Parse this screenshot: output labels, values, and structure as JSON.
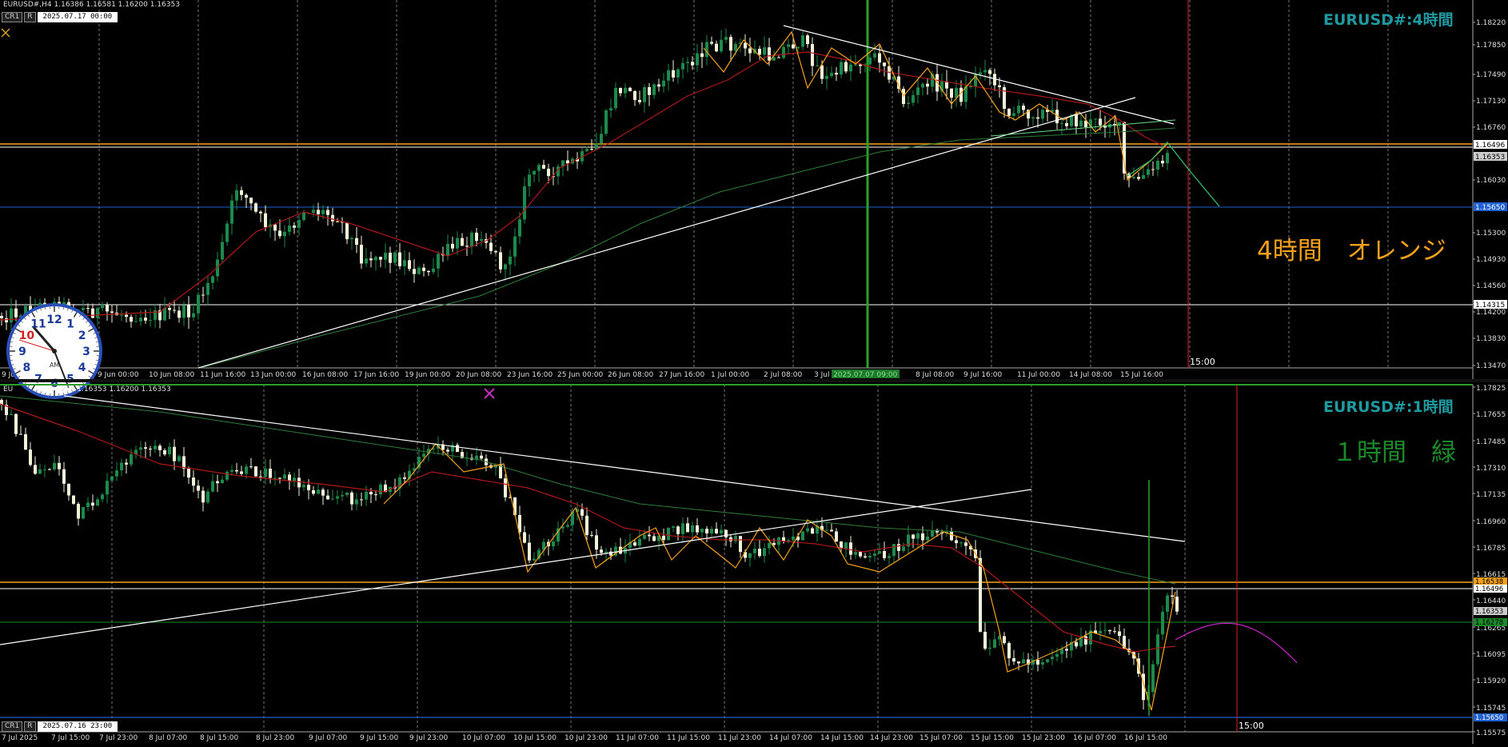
{
  "top_pane": {
    "info": "EURUSD#,H4  1.16386 1.16581 1.16200 1.16353",
    "cr_label": "CR1",
    "r_label": "R",
    "crosshair_date": "2025.07.17 00:00",
    "title": "EURUSD#:4時間",
    "note": "4時間　オレンジ",
    "note_color": "#f5a11c",
    "price_scale": [
      "1.18220",
      "1.17850",
      "1.17490",
      "1.17130",
      "1.16760",
      "1.16030",
      "1.15300",
      "1.14930",
      "1.14560",
      "1.14200",
      "1.13830",
      "1.13470"
    ],
    "price_tags": [
      {
        "label": "1.16496",
        "color": "#ffffff",
        "text_color": "#000000"
      },
      {
        "label": "1.16353",
        "color": "#cccccc",
        "text_color": "#000000"
      },
      {
        "label": "1.15650",
        "color": "#2060d0",
        "text_color": "#ffffff"
      },
      {
        "label": "1.14315",
        "color": "#ffffff",
        "text_color": "#000000"
      }
    ],
    "time_labels": [
      "9 Jun",
      "9 Jun 00:00",
      "10 Jun 08:00",
      "11 Jun 16:00",
      "13 Jun 00:00",
      "16 Jun 08:00",
      "17 Jun 16:00",
      "19 Jun 00:00",
      "20 Jun 08:00",
      "23 Jun 16:00",
      "25 Jun 00:00",
      "26 Jun 08:00",
      "27 Jun 16:00",
      "1 Jul 00:00",
      "2 Jul 08:00",
      "3 Jul",
      "2025.07.07 09:00",
      "8 Jul 08:00",
      "9 Jul 16:00",
      "11 Jul 00:00",
      "14 Jul 08:00",
      "15 Jul 16:00"
    ],
    "marker_time": "15:00"
  },
  "bottom_pane": {
    "info": "EURUSD#,H1  1.16278 1.16353 1.16200 1.16353",
    "info_short": "EU",
    "info_tail": "278 1.16353 1.16200 1.16353",
    "cr_label": "CR1",
    "r_label": "R",
    "crosshair_date": "2025.07.16 23:00",
    "title": "EURUSD#:1時間",
    "note": "１時間　緑",
    "note_color": "#1b8a2a",
    "price_scale": [
      "1.17825",
      "1.17655",
      "1.17485",
      "1.17310",
      "1.17135",
      "1.16960",
      "1.16785",
      "1.16615",
      "1.16440",
      "1.16265",
      "1.16095",
      "1.15920",
      "1.15745",
      "1.15575"
    ],
    "price_tags": [
      {
        "label": "1.16538",
        "color": "#f5a11c",
        "text_color": "#000000"
      },
      {
        "label": "1.16496",
        "color": "#ffffff",
        "text_color": "#000000"
      },
      {
        "label": "1.16353",
        "color": "#cccccc",
        "text_color": "#000000"
      },
      {
        "label": "1.16278",
        "color": "#1b8a2a",
        "text_color": "#000000"
      },
      {
        "label": "1.15650",
        "color": "#2060d0",
        "text_color": "#ffffff"
      }
    ],
    "time_labels": [
      "7 Jul 2025",
      "7 Jul 15:00",
      "7 Jul 23:00",
      "8 Jul 07:00",
      "8 Jul 15:00",
      "8 Jul 23:00",
      "9 Jul 07:00",
      "9 Jul 15:00",
      "9 Jul 23:00",
      "10 Jul 07:00",
      "10 Jul 15:00",
      "10 Jul 23:00",
      "11 Jul 07:00",
      "11 Jul 15:00",
      "11 Jul 23:00",
      "14 Jul 07:00",
      "14 Jul 15:00",
      "14 Jul 23:00",
      "15 Jul 07:00",
      "15 Jul 15:00",
      "15 Jul 23:00",
      "16 Jul 07:00",
      "16 Jul 15:00"
    ],
    "marker_time": "15:00"
  },
  "clock": {
    "numerals": [
      "12",
      "1",
      "2",
      "3",
      "4",
      "5",
      "6",
      "7",
      "8",
      "9",
      "10",
      "11"
    ],
    "ampm": "AM"
  },
  "colors": {
    "bull": "#1b8a4a",
    "bear": "#f2f2d8",
    "ma_red": "#b01818",
    "ma_green": "#2e7d3a",
    "zigzag": "#f5a11c",
    "forecast_green": "#2ebd6a",
    "forecast_magenta": "#c020c0",
    "orange_line": "#f5a11c",
    "blue_line": "#2060d0",
    "title": "#1f9aa0"
  }
}
